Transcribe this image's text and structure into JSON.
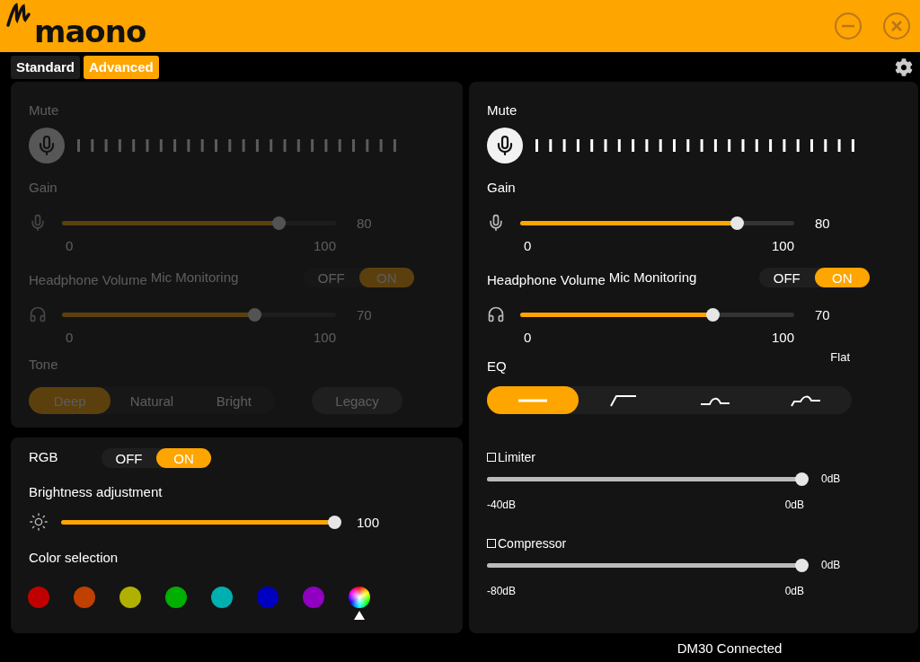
{
  "header": {
    "logo": "maono"
  },
  "tabs": [
    {
      "label": "Standard",
      "selected": false
    },
    {
      "label": "Advanced",
      "selected": true
    }
  ],
  "standard_panel": {
    "disabled": true,
    "mute_label": "Mute",
    "gain": {
      "label": "Gain",
      "level": 0.79,
      "reading": "80",
      "min": "0",
      "max": "100"
    },
    "headphone": {
      "label": "Headphone Volume",
      "level": 0.7,
      "reading": "70",
      "min": "0",
      "max": "100"
    },
    "monitoring": {
      "label": "Mic Monitoring",
      "options": [
        {
          "label": "OFF",
          "selected": false
        },
        {
          "label": "ON",
          "selected": true
        }
      ]
    },
    "tone": {
      "label": "Tone",
      "options": [
        {
          "label": "Deep",
          "selected": true
        },
        {
          "label": "Natural",
          "selected": false
        },
        {
          "label": "Bright",
          "selected": false
        }
      ]
    },
    "legacy_button": "Legacy"
  },
  "rgb_panel": {
    "label": "RGB",
    "toggle": [
      {
        "label": "OFF",
        "selected": false
      },
      {
        "label": "ON",
        "selected": true
      }
    ],
    "brightness": {
      "label": "Brightness adjustment",
      "level": 1,
      "reading": "100"
    },
    "color_label": "Color selection",
    "colors": [
      {
        "kind": "solid",
        "color": "#c00000",
        "selected": false
      },
      {
        "kind": "solid",
        "color": "#c04000",
        "selected": false
      },
      {
        "kind": "solid",
        "color": "#b0b000",
        "selected": false
      },
      {
        "kind": "solid",
        "color": "#00b000",
        "selected": false
      },
      {
        "kind": "solid",
        "color": "#00b0b0",
        "selected": false
      },
      {
        "kind": "solid",
        "color": "#0000c0",
        "selected": false
      },
      {
        "kind": "solid",
        "color": "#9000c0",
        "selected": false
      },
      {
        "kind": "spectrum",
        "selected": true
      }
    ]
  },
  "advanced_panel": {
    "disabled": false,
    "mute_label": "Mute",
    "gain": {
      "label": "Gain",
      "level": 0.79,
      "reading": "80",
      "min": "0",
      "max": "100"
    },
    "headphone": {
      "label": "Headphone Volume",
      "level": 0.7,
      "reading": "70",
      "min": "0",
      "max": "100"
    },
    "monitoring": {
      "label": "Mic Monitoring",
      "options": [
        {
          "label": "OFF",
          "selected": false
        },
        {
          "label": "ON",
          "selected": true
        }
      ]
    },
    "eq": {
      "label": "EQ",
      "preset": "Flat",
      "options": [
        {
          "kind": "flat",
          "selected": true
        },
        {
          "kind": "low_cut",
          "selected": false
        },
        {
          "kind": "bell",
          "selected": false
        },
        {
          "kind": "shelf_bell",
          "selected": false
        }
      ]
    },
    "limiter": {
      "label": "Limiter",
      "checked": false,
      "level": 1,
      "reading": "0dB",
      "min": "-40dB",
      "max": "0dB"
    },
    "compressor": {
      "label": "Compressor",
      "checked": false,
      "level": 1,
      "reading": "0dB",
      "min": "-80dB",
      "max": "0dB"
    }
  },
  "status": "DM30 Connected"
}
